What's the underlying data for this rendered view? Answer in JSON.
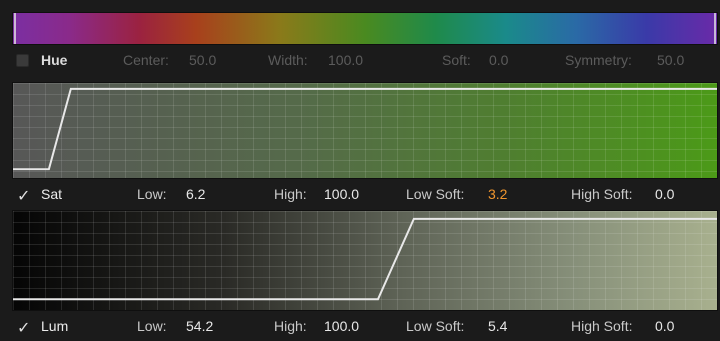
{
  "hue": {
    "checked": false,
    "name": "Hue",
    "center_label": "Center:",
    "center_value": "50.0",
    "width_label": "Width:",
    "width_value": "100.0",
    "soft_label": "Soft:",
    "soft_value": "0.0",
    "symmetry_label": "Symmetry:",
    "symmetry_value": "50.0"
  },
  "sat": {
    "checked": true,
    "check_glyph": "✓",
    "name": "Sat",
    "low_label": "Low:",
    "low_value": "6.2",
    "high_label": "High:",
    "high_value": "100.0",
    "low_soft_label": "Low Soft:",
    "low_soft_value": "3.2",
    "high_soft_label": "High Soft:",
    "high_soft_value": "0.0"
  },
  "lum": {
    "checked": true,
    "check_glyph": "✓",
    "name": "Lum",
    "low_label": "Low:",
    "low_value": "54.2",
    "high_label": "High:",
    "high_value": "100.0",
    "low_soft_label": "Low Soft:",
    "low_soft_value": "5.4",
    "high_soft_label": "High Soft:",
    "high_soft_value": "0.0"
  },
  "colors": {
    "accent_value": "#f0962e",
    "sat_gradient_end": "#4c9a18",
    "lum_gradient_end": "#a8b08e"
  }
}
